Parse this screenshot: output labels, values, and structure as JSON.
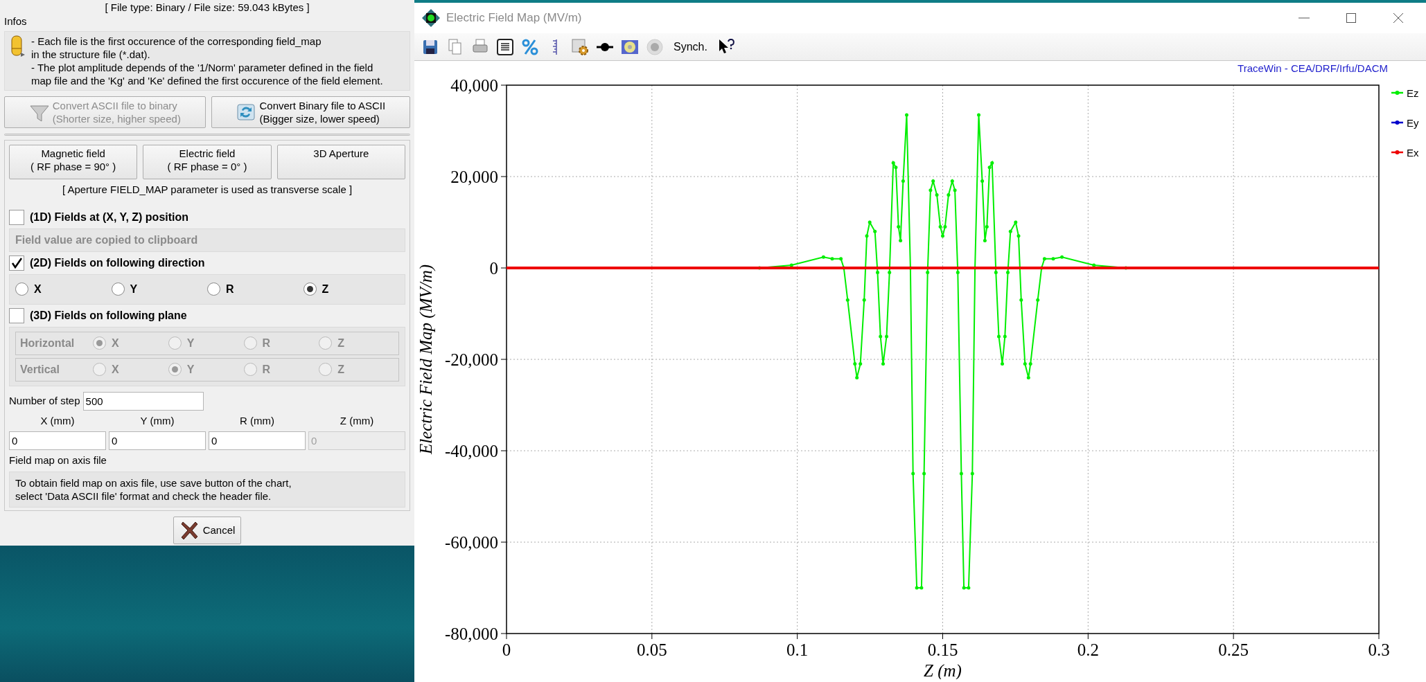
{
  "dialog": {
    "file_info": "[ File type: Binary  /  File size: 59.043 kBytes ]",
    "infos": {
      "label": "Infos",
      "lines": [
        "- Each file is the first occurence of the corresponding field_map",
        "in the structure file (*.dat).",
        "- The plot amplitude depends of the  '1/Norm' parameter defined in the field",
        "map file and the 'Kg' and 'Ke' defined the first occurence of the field element."
      ]
    },
    "convert_buttons": [
      {
        "kind": "to-binary",
        "lines": [
          "Convert ASCII file to binary",
          "(Shorter size, higher speed)"
        ],
        "disabled": true
      },
      {
        "kind": "to-ascii",
        "lines": [
          "Convert Binary file to ASCII",
          "(Bigger size, lower speed)"
        ],
        "disabled": false
      }
    ],
    "progress": {
      "level": 0
    },
    "mode_buttons": [
      {
        "lines": [
          "Magnetic field",
          "( RF phase = 90° )"
        ]
      },
      {
        "lines": [
          "Electric field",
          "( RF phase = 0° )"
        ]
      },
      {
        "lines": [
          "3D Aperture"
        ]
      }
    ],
    "aperture_note": "[ Aperture FIELD_MAP parameter is used as transverse scale ]",
    "fields_1d": {
      "label": "(1D) Fields at (X, Y, Z) position",
      "checked": false,
      "note": "Field value are copied to clipboard"
    },
    "fields_2d": {
      "label": "(2D) Fields on following direction",
      "checked": true,
      "options": [
        {
          "label": "X",
          "selected": false
        },
        {
          "label": "Y",
          "selected": false
        },
        {
          "label": "R",
          "selected": false
        },
        {
          "label": "Z",
          "selected": true
        }
      ]
    },
    "fields_3d": {
      "label": "(3D) Fields on following plane",
      "checked": false,
      "disabled": true,
      "planes": [
        {
          "label": "Horizontal",
          "options": [
            {
              "label": "X",
              "selected": true
            },
            {
              "label": "Y",
              "selected": false
            },
            {
              "label": "R",
              "selected": false
            },
            {
              "label": "Z",
              "selected": false
            }
          ]
        },
        {
          "label": "Vertical",
          "options": [
            {
              "label": "X",
              "selected": false
            },
            {
              "label": "Y",
              "selected": true
            },
            {
              "label": "R",
              "selected": false
            },
            {
              "label": "Z",
              "selected": false
            }
          ]
        }
      ]
    },
    "steps": {
      "label": "Number of step",
      "value": "500"
    },
    "coordinates": [
      {
        "label": "X (mm)",
        "value": "0",
        "disabled": false
      },
      {
        "label": "Y (mm)",
        "value": "0",
        "disabled": false
      },
      {
        "label": "R (mm)",
        "value": "0",
        "disabled": false
      },
      {
        "label": "Z (mm)",
        "value": "0",
        "disabled": true
      }
    ],
    "axis_file": {
      "label": "Field map on axis file",
      "lines": [
        "To obtain field map on axis file, use save button of the chart,",
        "select 'Data ASCII file' format and check the header file."
      ]
    },
    "cancel": "Cancel"
  },
  "chart_window": {
    "title": "Electric Field Map (MV/m)",
    "synch": "Synch.",
    "credit": "TraceWin - CEA/DRF/Irfu/DACM",
    "chart_data": {
      "type": "line",
      "grid": true,
      "legend": true,
      "xlabel": "Z (m)",
      "ylabel": "Electric Field Map (MV/m)",
      "xlim": [
        0,
        0.3
      ],
      "ylim": [
        -80000,
        40000
      ],
      "xticks": [
        0,
        0.05,
        0.1,
        0.15,
        0.2,
        0.25,
        0.3
      ],
      "yticks": [
        {
          "value": 40000,
          "label": "40,000"
        },
        {
          "value": 20000,
          "label": "20,000"
        },
        0,
        {
          "value": -20000,
          "label": "-20,000"
        },
        {
          "value": -40000,
          "label": "-40,000"
        },
        {
          "value": -60000,
          "label": "-60,000"
        },
        {
          "value": -80000,
          "label": "-80,000"
        }
      ],
      "x": [
        0,
        0.087,
        0.098,
        0.109,
        0.112,
        0.115,
        0.116,
        0.1173,
        0.1198,
        0.1205,
        0.1217,
        0.123,
        0.1239,
        0.1249,
        0.1267,
        0.1276,
        0.1286,
        0.1295,
        0.1307,
        0.1317,
        0.133,
        0.1339,
        0.1348,
        0.1355,
        0.1364,
        0.1376,
        0.1389,
        0.1398,
        0.1411,
        0.1427,
        0.1436,
        0.1448,
        0.1458,
        0.1467,
        0.148,
        0.1492,
        0.15,
        0.1508,
        0.152,
        0.1533,
        0.1542,
        0.1552,
        0.1564,
        0.1573,
        0.1589,
        0.1602,
        0.1611,
        0.1624,
        0.1636,
        0.1645,
        0.1652,
        0.1661,
        0.167,
        0.1683,
        0.1693,
        0.1705,
        0.1714,
        0.1724,
        0.1733,
        0.1751,
        0.1761,
        0.177,
        0.1783,
        0.1795,
        0.1802,
        0.1827,
        0.184,
        0.185,
        0.188,
        0.191,
        0.202,
        0.213,
        0.3
      ],
      "series": [
        {
          "name": "Ez",
          "color": "#00ee00",
          "values": [
            null,
            0,
            600,
            2400,
            2000,
            2000,
            0,
            -7000,
            -21000,
            -24000,
            -21000,
            -7000,
            7000,
            10000,
            8000,
            -1000,
            -15000,
            -21000,
            -15000,
            -1000,
            23000,
            22000,
            9000,
            6000,
            19000,
            33500,
            0,
            -45000,
            -70000,
            -70000,
            -45000,
            -1000,
            17000,
            19000,
            16000,
            9000,
            7000,
            9000,
            16000,
            19000,
            17000,
            -1000,
            -45000,
            -70000,
            -70000,
            -45000,
            0,
            33500,
            19000,
            6000,
            9000,
            22000,
            23000,
            -1000,
            -15000,
            -21000,
            -15000,
            -1000,
            8000,
            10000,
            7000,
            -7000,
            -21000,
            -24000,
            -21000,
            -7000,
            0,
            2000,
            2000,
            2400,
            600,
            0,
            null
          ]
        },
        {
          "name": "Ey",
          "color": "#0000cc",
          "values": [
            null,
            null,
            null,
            null,
            null,
            null,
            null,
            null,
            null,
            null,
            null,
            null,
            null,
            null,
            null,
            null,
            null,
            null,
            null,
            null,
            null,
            null,
            null,
            null,
            null,
            null,
            null,
            null,
            null,
            null,
            null,
            null,
            null,
            null,
            null,
            null,
            null,
            null,
            null,
            null,
            null,
            null,
            null,
            null,
            null,
            null,
            null,
            null,
            null,
            null,
            null,
            null,
            null,
            null,
            null,
            null,
            null,
            null,
            null,
            null,
            null,
            null,
            null,
            null,
            null,
            null,
            null,
            null,
            null,
            null,
            null,
            null,
            null
          ]
        },
        {
          "name": "Ex",
          "color": "#ee0000",
          "values": [
            0,
            0,
            0,
            0,
            0,
            0,
            0,
            0,
            0,
            0,
            0,
            0,
            0,
            0,
            0,
            0,
            0,
            0,
            0,
            0,
            0,
            0,
            0,
            0,
            0,
            0,
            0,
            0,
            0,
            0,
            0,
            0,
            0,
            0,
            0,
            0,
            0,
            0,
            0,
            0,
            0,
            0,
            0,
            0,
            0,
            0,
            0,
            0,
            0,
            0,
            0,
            0,
            0,
            0,
            0,
            0,
            0,
            0,
            0,
            0,
            0,
            0,
            0,
            0,
            0,
            0,
            0,
            0,
            0,
            0,
            0,
            0,
            0
          ]
        }
      ]
    }
  }
}
